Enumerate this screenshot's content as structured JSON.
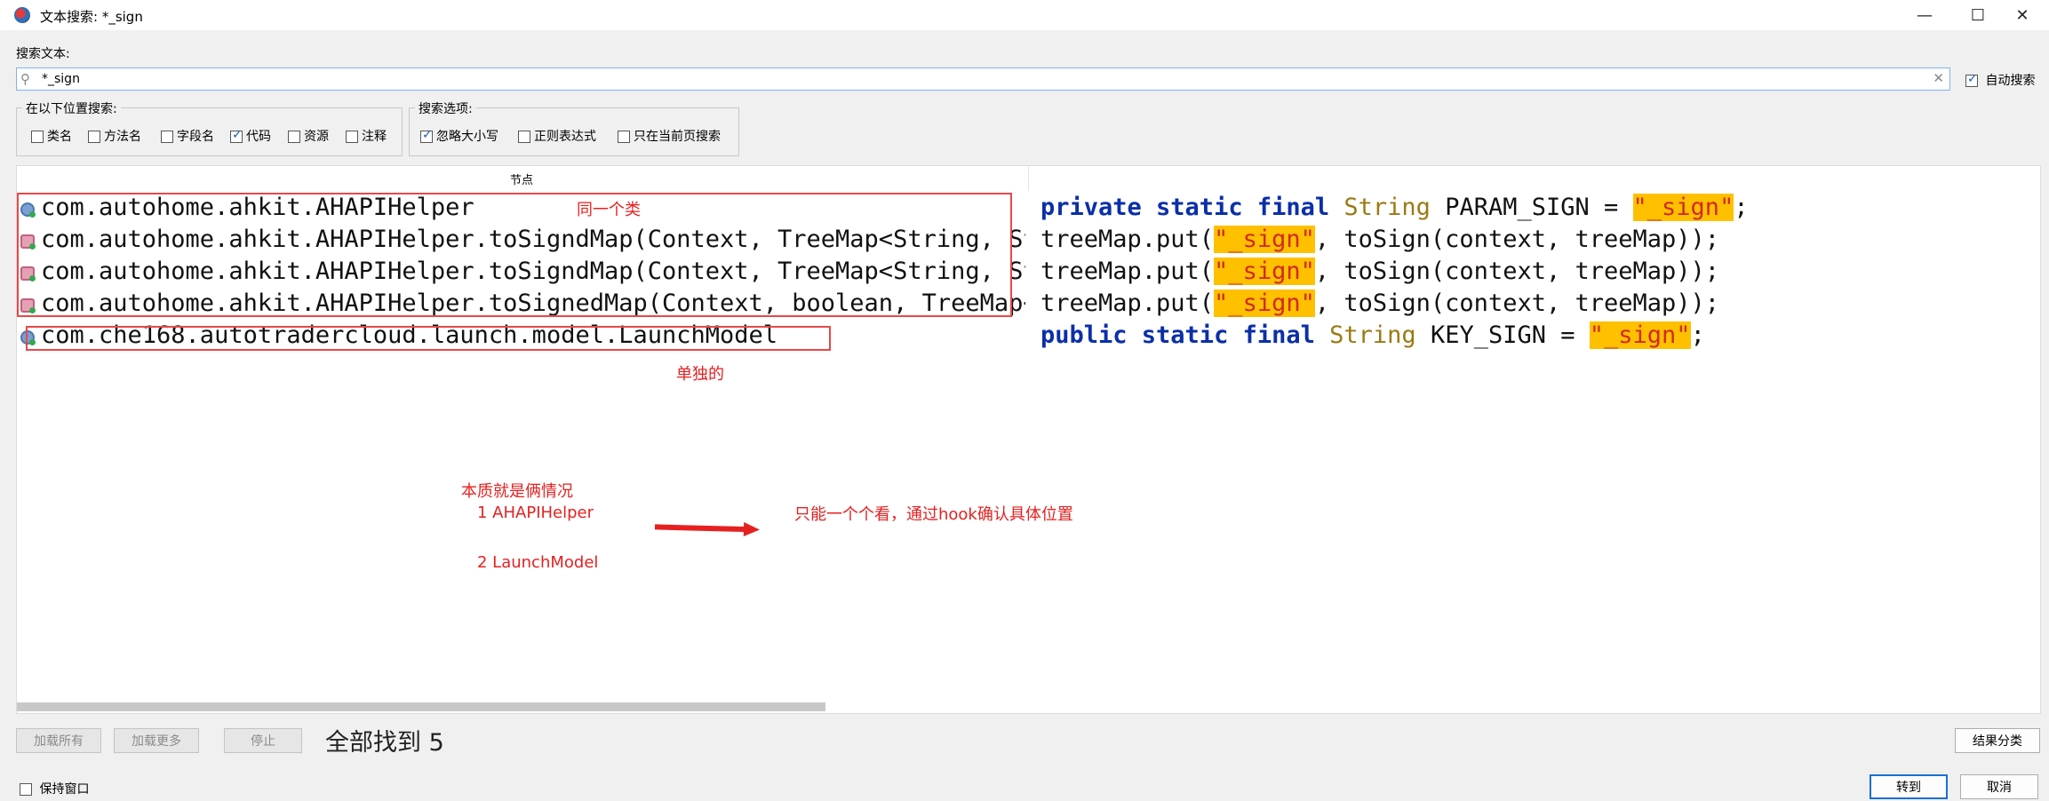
{
  "window": {
    "title": "文本搜索: *_sign",
    "minimize": "—",
    "maximize": "☐",
    "close": "✕"
  },
  "search": {
    "label": "搜索文本:",
    "value": "*_sign",
    "auto_search": "自动搜索",
    "auto_search_checked": true
  },
  "search_in": {
    "title": "在以下位置搜索:",
    "options": [
      {
        "label": "类名",
        "checked": false
      },
      {
        "label": "方法名",
        "checked": false
      },
      {
        "label": "字段名",
        "checked": false
      },
      {
        "label": "代码",
        "checked": true
      },
      {
        "label": "资源",
        "checked": false
      },
      {
        "label": "注释",
        "checked": false
      }
    ]
  },
  "search_options": {
    "title": "搜索选项:",
    "options": [
      {
        "label": "忽略大小写",
        "checked": true
      },
      {
        "label": "正则表达式",
        "checked": false
      },
      {
        "label": "只在当前页搜索",
        "checked": false
      }
    ]
  },
  "results": {
    "column_header": "节点",
    "rows": [
      {
        "icon": "class",
        "node": "com.autohome.ahkit.AHAPIHelper",
        "code": [
          "kw:private static final",
          "type:String",
          "txt:PARAM_SIGN =",
          "hl:\"_sign\"",
          "txt:;"
        ]
      },
      {
        "icon": "method",
        "node": "com.autohome.ahkit.AHAPIHelper.toSigndMap(Context, TreeMap<String, String>)",
        "code": [
          "txt:treeMap.put(",
          "hl:\"_sign\"",
          "txt:, toSign(context, treeMap));"
        ]
      },
      {
        "icon": "method",
        "node": "com.autohome.ahkit.AHAPIHelper.toSigndMap(Context, TreeMap<String, String>)",
        "code": [
          "txt:treeMap.put(",
          "hl:\"_sign\"",
          "txt:, toSign(context, treeMap));"
        ]
      },
      {
        "icon": "method",
        "node": "com.autohome.ahkit.AHAPIHelper.toSignedMap(Context, boolean, TreeMap<String, String>)",
        "code": [
          "txt:treeMap.put(",
          "hl:\"_sign\"",
          "txt:, toSign(context, treeMap));"
        ]
      },
      {
        "icon": "class",
        "node": "com.che168.autotradercloud.launch.model.LaunchModel",
        "code": [
          "kw:public static final",
          "type:String",
          "txt:KEY_SIGN =",
          "hl:\"_sign\"",
          "txt:;"
        ]
      }
    ]
  },
  "annotations": {
    "same_class": "同一个类",
    "single": "单独的",
    "essence": "本质就是俩情况",
    "case1": "1 AHAPIHelper",
    "case2": "2 LaunchModel",
    "hook_note": "只能一个个看，通过hook确认具体位置"
  },
  "footer": {
    "load_all": "加载所有",
    "load_more": "加载更多",
    "stop": "停止",
    "found_text": "全部找到  5",
    "group_results": "结果分类",
    "keep_window": "保持窗口",
    "keep_window_checked": false,
    "goto": "转到",
    "cancel": "取消"
  }
}
